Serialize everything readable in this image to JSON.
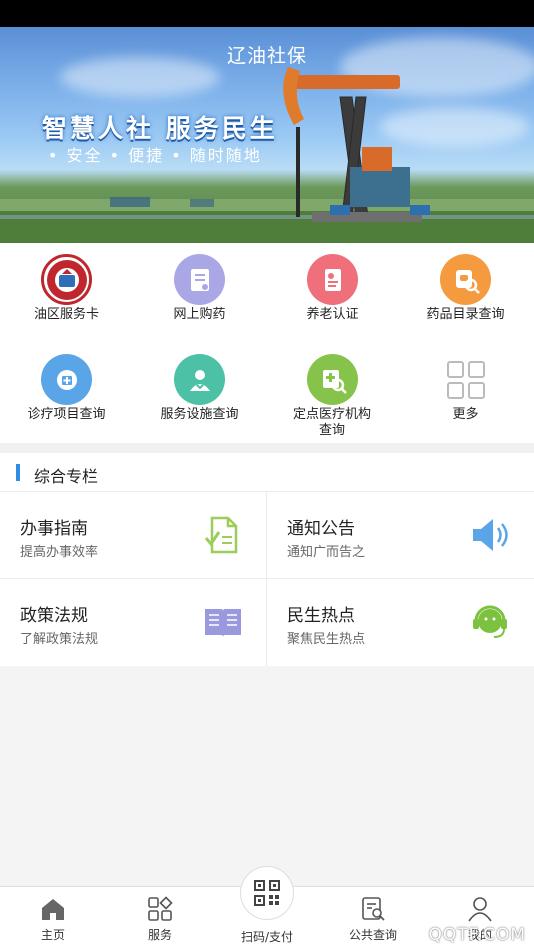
{
  "banner": {
    "title": "辽油社保",
    "slogan": "智慧人社  服务民生",
    "tagline": "• 安全  • 便捷  • 随时随地"
  },
  "grid": [
    {
      "label": "油区服务卡",
      "icon": "service-card-icon",
      "color": "#c0262d"
    },
    {
      "label": "网上购药",
      "icon": "online-pharmacy-icon",
      "color": "#a9a7e6"
    },
    {
      "label": "养老认证",
      "icon": "pension-auth-icon",
      "color": "#ef6f7a"
    },
    {
      "label": "药品目录查询",
      "icon": "drug-catalog-icon",
      "color": "#f59a3e"
    },
    {
      "label": "诊疗项目查询",
      "icon": "diagnosis-query-icon",
      "color": "#5aa5e8"
    },
    {
      "label": "服务设施查询",
      "icon": "facility-query-icon",
      "color": "#4cc1a6"
    },
    {
      "label": "定点医疗机构查询",
      "icon": "medical-institution-icon",
      "color": "#86c34a"
    },
    {
      "label": "更多",
      "icon": "more-grid-icon",
      "color": "#cccccc"
    }
  ],
  "section": {
    "title": "综合专栏"
  },
  "cards": [
    {
      "title": "办事指南",
      "subtitle": "提高办事效率",
      "icon": "guide-document-icon",
      "color": "#9ccc5a"
    },
    {
      "title": "通知公告",
      "subtitle": "通知广而告之",
      "icon": "speaker-icon",
      "color": "#5aa5e8"
    },
    {
      "title": "政策法规",
      "subtitle": "了解政策法规",
      "icon": "book-icon",
      "color": "#9b99dd"
    },
    {
      "title": "民生热点",
      "subtitle": "聚焦民生热点",
      "icon": "headset-icon",
      "color": "#7cc240"
    }
  ],
  "tabs": [
    {
      "label": "主页",
      "icon": "home-icon"
    },
    {
      "label": "服务",
      "icon": "services-icon"
    },
    {
      "label": "扫码/支付",
      "icon": "qr-scan-icon"
    },
    {
      "label": "公共查询",
      "icon": "public-query-icon"
    },
    {
      "label": "我的",
      "icon": "profile-icon"
    }
  ],
  "watermark": "QQTF.COM"
}
